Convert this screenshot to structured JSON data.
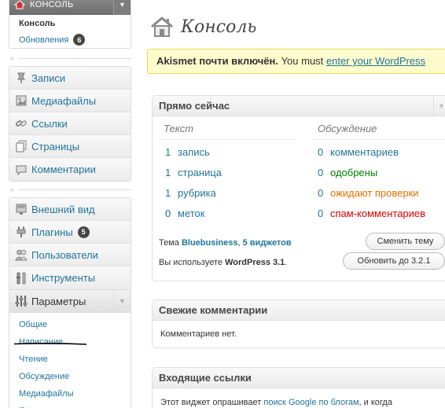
{
  "sidebar": {
    "top_menu": {
      "label": "Консоль",
      "current": "Консоль",
      "updates_label": "Обновления",
      "updates_count": "6"
    },
    "group1": [
      {
        "label": "Записи",
        "icon": "pin-icon"
      },
      {
        "label": "Медиафайлы",
        "icon": "media-icon"
      },
      {
        "label": "Ссылки",
        "icon": "links-icon"
      },
      {
        "label": "Страницы",
        "icon": "pages-icon"
      },
      {
        "label": "Комментарии",
        "icon": "comments-icon"
      }
    ],
    "group2": [
      {
        "label": "Внешний вид",
        "icon": "appearance-icon"
      },
      {
        "label": "Плагины",
        "icon": "plugins-icon",
        "badge": "5"
      },
      {
        "label": "Пользователи",
        "icon": "users-icon"
      },
      {
        "label": "Инструменты",
        "icon": "tools-icon"
      }
    ],
    "settings": {
      "label": "Параметры",
      "subitems": [
        "Общие",
        "Написание",
        "Чтение",
        "Обсуждение",
        "Медиафайлы",
        "Приватность"
      ]
    }
  },
  "main": {
    "page_title": "Консоль",
    "notice": {
      "bold": "Akismet почти включён.",
      "text": " You must ",
      "link": "enter your WordPress"
    },
    "right_now": {
      "title": "Прямо сейчас",
      "content_head": "Текст",
      "discussion_head": "Обсуждение",
      "content_rows": [
        {
          "num": "1",
          "label": "запись"
        },
        {
          "num": "1",
          "label": "страница"
        },
        {
          "num": "1",
          "label": "рубрика"
        },
        {
          "num": "0",
          "label": "меток"
        }
      ],
      "discussion_rows": [
        {
          "num": "0",
          "label": "комментариев",
          "color": "#21759b"
        },
        {
          "num": "0",
          "label": "одобрены",
          "color": "#008000"
        },
        {
          "num": "0",
          "label": "ожидают проверки",
          "color": "#e66f00"
        },
        {
          "num": "0",
          "label": "спам-комментариев",
          "color": "#dd0000"
        }
      ],
      "theme_prefix": "Тема ",
      "theme_name": "Bluebusiness",
      "theme_sep": ", ",
      "widgets": "5 виджетов",
      "change_theme_button": "Сменить тему",
      "version_prefix": "Вы используете ",
      "version": "WordPress 3.1",
      "version_suffix": ".",
      "update_button": "Обновить до 3.2.1"
    },
    "recent_comments": {
      "title": "Свежие комментарии",
      "text": "Комментариев нет."
    },
    "incoming_links": {
      "title": "Входящие ссылки",
      "text_prefix": "Этот виджет опрашивает ",
      "link": "поиск Google по блогам",
      "text_suffix": ", и когда"
    }
  },
  "colors": {
    "link": "#21759b",
    "approved": "#008000",
    "pending": "#e66f00",
    "spam": "#dd0000",
    "annotation_underline": "#000000"
  }
}
